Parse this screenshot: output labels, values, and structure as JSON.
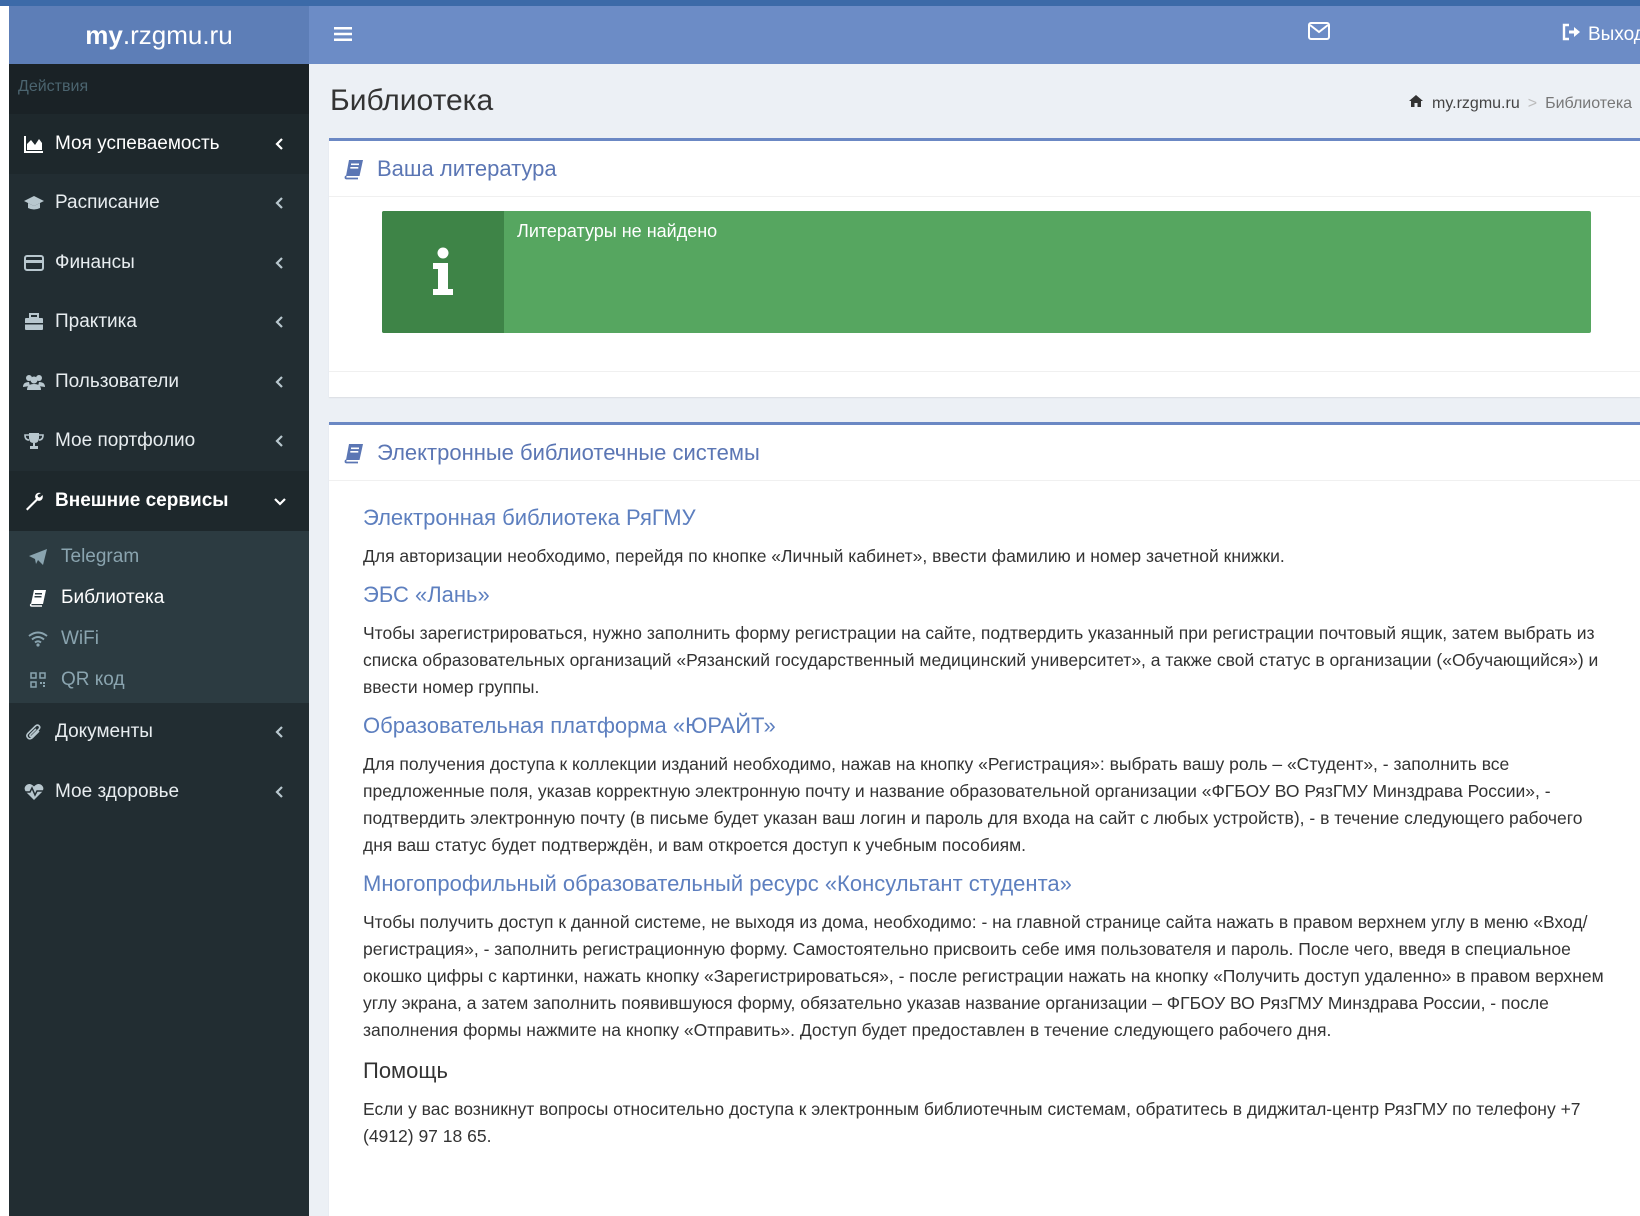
{
  "header": {
    "logo_bold": "my",
    "logo_rest": ".rzgmu.ru",
    "logout_label": "Выход"
  },
  "sidebar": {
    "header": "Действия",
    "items": [
      {
        "label": "Моя успеваемость",
        "icon": "chart-area-icon"
      },
      {
        "label": "Расписание",
        "icon": "graduation-cap-icon"
      },
      {
        "label": "Финансы",
        "icon": "credit-card-icon"
      },
      {
        "label": "Практика",
        "icon": "briefcase-icon"
      },
      {
        "label": "Пользователи",
        "icon": "users-icon"
      },
      {
        "label": "Мое портфолио",
        "icon": "trophy-icon"
      },
      {
        "label": "Внешние сервисы",
        "icon": "wrench-icon"
      }
    ],
    "subitems": [
      {
        "label": "Telegram",
        "icon": "telegram-icon"
      },
      {
        "label": "Библиотека",
        "icon": "book-icon"
      },
      {
        "label": "WiFi",
        "icon": "wifi-icon"
      },
      {
        "label": "QR код",
        "icon": "qrcode-icon"
      }
    ],
    "items_after": [
      {
        "label": "Документы",
        "icon": "paperclip-icon"
      },
      {
        "label": "Мое здоровье",
        "icon": "heartbeat-icon"
      }
    ]
  },
  "page": {
    "title": "Библиотека",
    "breadcrumb_home": "my.rzgmu.ru",
    "breadcrumb_current": "Библиотека"
  },
  "literature": {
    "title": "Ваша литература",
    "empty_message": "Литературы не найдено"
  },
  "systems": {
    "title": "Электронные библиотечные системы",
    "entries": [
      {
        "title": "Электронная библиотека РяГМУ",
        "text": "Для авторизации необходимо, перейдя по кнопке «Личный кабинет», ввести фамилию и номер зачетной книжки."
      },
      {
        "title": "ЭБС «Лань»",
        "text": "Чтобы зарегистрироваться, нужно заполнить форму регистрации на сайте, подтвердить указанный при регистрации почтовый ящик, затем выбрать из списка образовательных организаций «Рязанский государственный медицинский университет», а также свой статус в организации («Обучающийся») и ввести номер группы."
      },
      {
        "title": "Образовательная платформа «ЮРАЙТ»",
        "text": "Для получения доступа к коллекции изданий необходимо, нажав на кнопку «Регистрация»: выбрать вашу роль – «Студент», - заполнить все предложенные поля, указав корректную электронную почту и название образовательной организации «ФГБОУ ВО РязГМУ Минздрава России», - подтвердить электронную почту (в письме будет указан ваш логин и пароль для входа на сайт с любых устройств), - в течение следующего рабочего дня ваш статус будет подтверждён, и вам откроется доступ к учебным пособиям."
      },
      {
        "title": "Многопрофильный образовательный ресурс «Консультант студента»",
        "text": "Чтобы получить доступ к данной системе, не выходя из дома, необходимо: - на главной странице сайта нажать в правом верхнем углу в меню «Вход/регистрация», - заполнить регистрационную форму. Самостоятельно присвоить себе имя пользователя и пароль. После чего, введя в специальное окошко цифры с картинки, нажать кнопку «Зарегистрироваться», - после регистрации нажать на кнопку «Получить доступ удаленно» в правом верхнем углу экрана, а затем заполнить появившуюся форму, обязательно указав название организации – ФГБОУ ВО РязГМУ Минздрава России, - после заполнения формы нажмите на кнопку «Отправить». Доступ будет предоставлен в течение следующего рабочего дня."
      }
    ],
    "help_title": "Помощь",
    "help_text": "Если у вас возникнут вопросы относительно доступа к электронным библиотечным системам, обратитесь в диджитал-центр РязГМУ по телефону +7 (4912) 97 18 65."
  },
  "colors": {
    "header": "#6c8cc6",
    "logo_bg": "#5d7eb7",
    "sidebar": "#222d32",
    "accent_link": "#5d7fbf",
    "callout": "#56a660",
    "callout_icon_bg": "#3e8447"
  }
}
